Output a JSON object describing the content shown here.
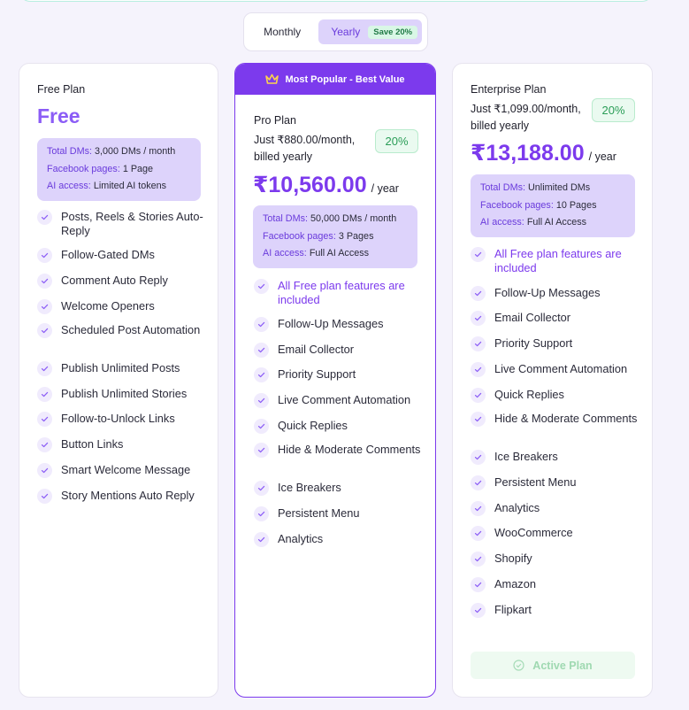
{
  "billing_toggle": {
    "monthly_label": "Monthly",
    "yearly_label": "Yearly",
    "save_badge": "Save 20%",
    "selected": "Yearly"
  },
  "plans": {
    "free": {
      "name": "Free Plan",
      "price": "Free",
      "info": [
        {
          "key": "Total DMs:",
          "value": "3,000 DMs / month"
        },
        {
          "key": "Facebook pages:",
          "value": "1 Page"
        },
        {
          "key": "AI access:",
          "value": "Limited AI tokens"
        }
      ],
      "features": [
        "Posts, Reels & Stories Auto-Reply",
        "Follow-Gated DMs",
        "Comment Auto Reply",
        "Welcome Openers",
        "Scheduled Post Automation",
        "Publish Unlimited Posts",
        "Publish Unlimited Stories",
        "Follow-to-Unlock Links",
        "Button Links",
        "Smart Welcome Message",
        "Story Mentions Auto Reply"
      ]
    },
    "pro": {
      "banner": "Most Popular - Best Value",
      "name": "Pro Plan",
      "price_line_1": "Just ₹880.00/month,",
      "price_line_2": "billed yearly",
      "discount": "20%",
      "amount": "₹10,560.00",
      "per": "/ year",
      "info": [
        {
          "key": "Total DMs:",
          "value": "50,000 DMs / month"
        },
        {
          "key": "Facebook pages:",
          "value": "3 Pages"
        },
        {
          "key": "AI access:",
          "value": "Full AI Access"
        }
      ],
      "features": [
        "All Free plan features are included",
        "Follow-Up Messages",
        "Email Collector",
        "Priority Support",
        "Live Comment Automation",
        "Quick Replies",
        "Hide & Moderate Comments",
        "Ice Breakers",
        "Persistent Menu",
        "Analytics"
      ]
    },
    "enterprise": {
      "name": "Enterprise Plan",
      "price_line_1": "Just ₹1,099.00/month,",
      "price_line_2": "billed yearly",
      "discount": "20%",
      "amount": "₹13,188.00",
      "per": "/ year",
      "info": [
        {
          "key": "Total DMs:",
          "value": "Unlimited DMs"
        },
        {
          "key": "Facebook pages:",
          "value": "10 Pages"
        },
        {
          "key": "AI access:",
          "value": "Full AI Access"
        }
      ],
      "features": [
        "All Free plan features are included",
        "Follow-Up Messages",
        "Email Collector",
        "Priority Support",
        "Live Comment Automation",
        "Quick Replies",
        "Hide & Moderate Comments",
        "Ice Breakers",
        "Persistent Menu",
        "Analytics",
        "WooCommerce",
        "Shopify",
        "Amazon",
        "Flipkart"
      ],
      "active_button": "Active Plan"
    }
  },
  "colors": {
    "accent": "#7c3aed",
    "info_bg": "#ddd3fb",
    "success": "#2a9d57"
  }
}
